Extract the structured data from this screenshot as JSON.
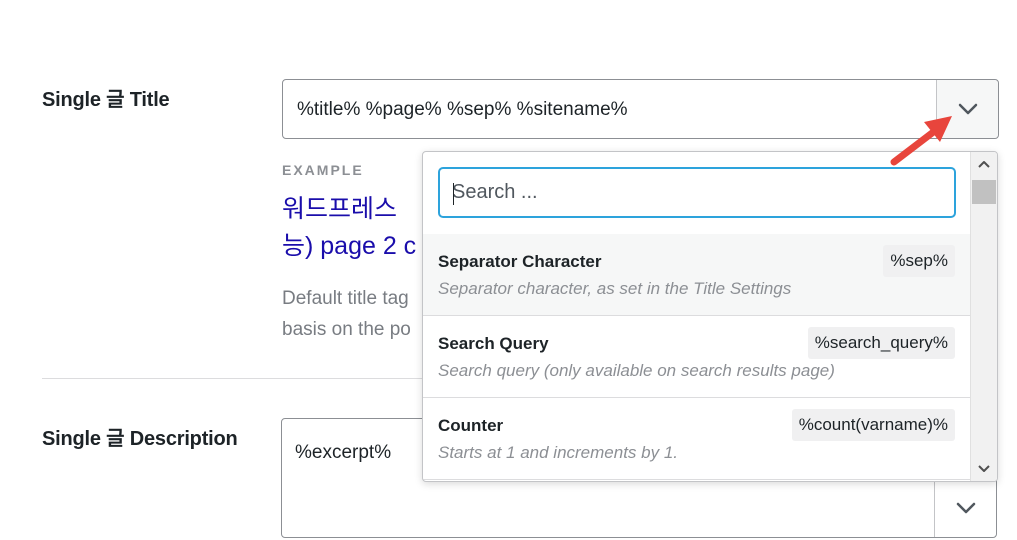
{
  "title_setting": {
    "label": "Single 글 Title",
    "value": "%title% %page% %sep% %sitename%"
  },
  "example": {
    "label": "EXAMPLE",
    "line1": "워드프레스",
    "line2": "능) page 2 c"
  },
  "helper": {
    "line1": "Default title tag",
    "line2": "basis on the po"
  },
  "description_setting": {
    "label": "Single 글 Description",
    "value": "%excerpt%"
  },
  "dropdown": {
    "search_placeholder": "Search ...",
    "items": [
      {
        "title": "Separator Character",
        "description": "Separator character, as set in the Title Settings",
        "tag": "%sep%"
      },
      {
        "title": "Search Query",
        "description": "Search query (only available on search results page)",
        "tag": "%search_query%"
      },
      {
        "title": "Counter",
        "description": "Starts at 1 and increments by 1.",
        "tag": "%count(varname)%"
      }
    ]
  },
  "colors": {
    "accent": "#2da3dc",
    "arrow": "#e8453c",
    "link": "#1a0dab"
  },
  "icons": {
    "dropdown_toggle": "chevron-down-icon",
    "annotation": "red-arrow-icon"
  }
}
